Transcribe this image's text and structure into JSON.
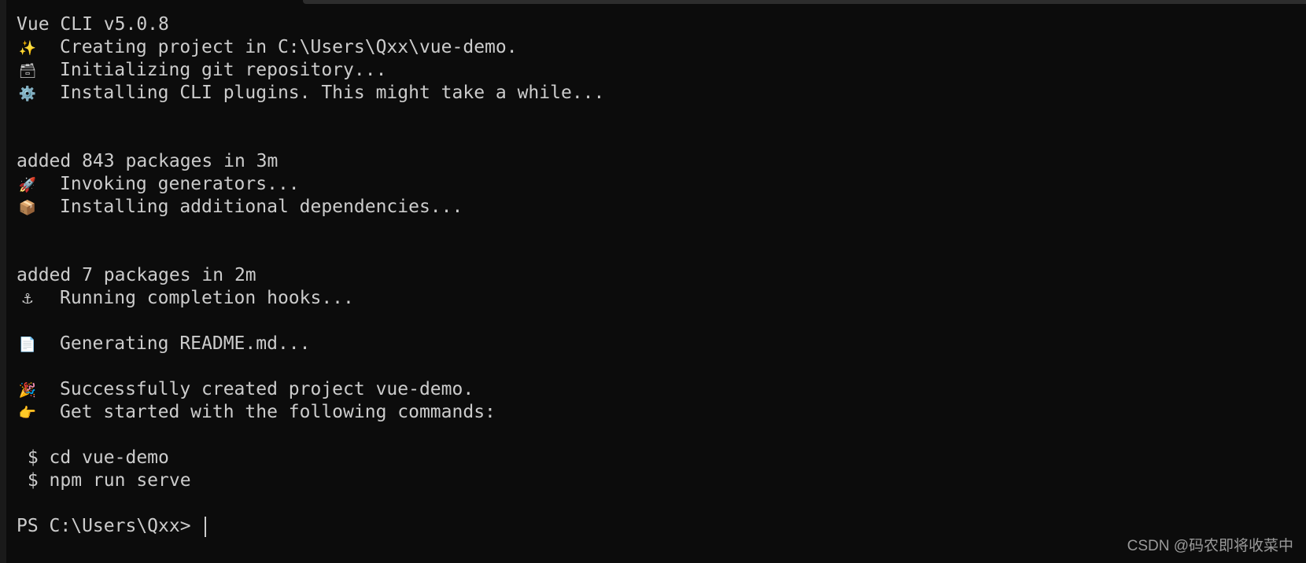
{
  "terminal": {
    "lines": [
      {
        "icon": "",
        "text": "Vue CLI v5.0.8"
      },
      {
        "icon": "✨",
        "text": "Creating project in C:\\Users\\Qxx\\vue-demo."
      },
      {
        "icon": "🗃",
        "text": "Initializing git repository..."
      },
      {
        "icon": "⚙️",
        "text": "Installing CLI plugins. This might take a while..."
      },
      {
        "icon": "",
        "text": ""
      },
      {
        "icon": "",
        "text": ""
      },
      {
        "icon": "",
        "text": "added 843 packages in 3m"
      },
      {
        "icon": "🚀",
        "text": "Invoking generators..."
      },
      {
        "icon": "📦",
        "text": "Installing additional dependencies..."
      },
      {
        "icon": "",
        "text": ""
      },
      {
        "icon": "",
        "text": ""
      },
      {
        "icon": "",
        "text": "added 7 packages in 2m"
      },
      {
        "icon": "⚓",
        "text": "Running completion hooks..."
      },
      {
        "icon": "",
        "text": ""
      },
      {
        "icon": "📄",
        "text": "Generating README.md..."
      },
      {
        "icon": "",
        "text": ""
      },
      {
        "icon": "🎉",
        "text": "Successfully created project vue-demo."
      },
      {
        "icon": "👉",
        "text": "Get started with the following commands:"
      },
      {
        "icon": "",
        "text": ""
      },
      {
        "icon": "",
        "text": " $ cd vue-demo"
      },
      {
        "icon": "",
        "text": " $ npm run serve"
      },
      {
        "icon": "",
        "text": ""
      }
    ],
    "prompt": "PS C:\\Users\\Qxx> ",
    "icon_names": {
      "1": "sparkles-icon",
      "2": "card-file-box-icon",
      "3": "gear-icon",
      "7": "rocket-icon",
      "8": "package-icon",
      "12": "anchor-icon",
      "14": "page-icon",
      "16": "party-popper-icon",
      "17": "pointing-right-icon"
    }
  },
  "watermark": "CSDN @码农即将收菜中",
  "colors": {
    "background": "#0c0c0c",
    "foreground": "#cccccc"
  }
}
